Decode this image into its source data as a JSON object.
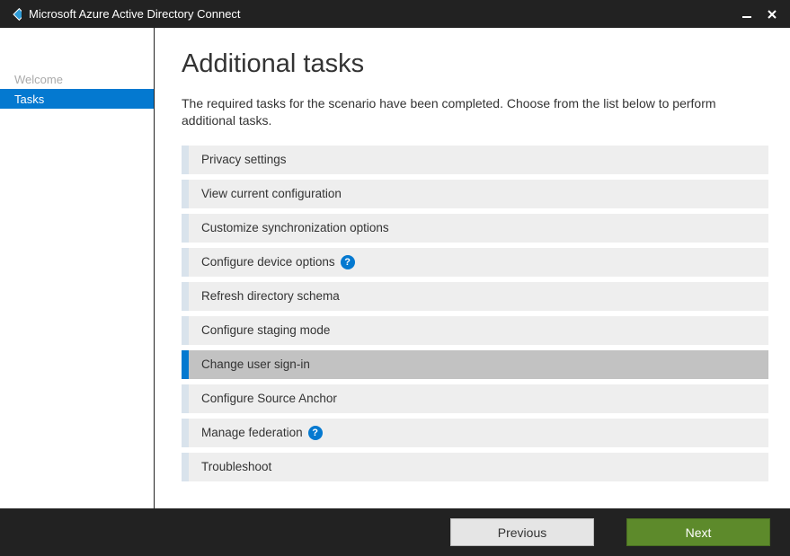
{
  "window": {
    "title": "Microsoft Azure Active Directory Connect"
  },
  "sidebar": {
    "items": [
      {
        "label": "Welcome",
        "active": false
      },
      {
        "label": "Tasks",
        "active": true
      }
    ]
  },
  "main": {
    "title": "Additional tasks",
    "description": "The required tasks for the scenario have been completed. Choose from the list below to perform additional tasks.",
    "tasks": [
      {
        "label": "Privacy settings",
        "help": false,
        "selected": false
      },
      {
        "label": "View current configuration",
        "help": false,
        "selected": false
      },
      {
        "label": "Customize synchronization options",
        "help": false,
        "selected": false
      },
      {
        "label": "Configure device options",
        "help": true,
        "selected": false
      },
      {
        "label": "Refresh directory schema",
        "help": false,
        "selected": false
      },
      {
        "label": "Configure staging mode",
        "help": false,
        "selected": false
      },
      {
        "label": "Change user sign-in",
        "help": false,
        "selected": true
      },
      {
        "label": "Configure Source Anchor",
        "help": false,
        "selected": false
      },
      {
        "label": "Manage federation",
        "help": true,
        "selected": false
      },
      {
        "label": "Troubleshoot",
        "help": false,
        "selected": false
      }
    ]
  },
  "footer": {
    "previous_label": "Previous",
    "next_label": "Next"
  },
  "help_glyph": "?"
}
